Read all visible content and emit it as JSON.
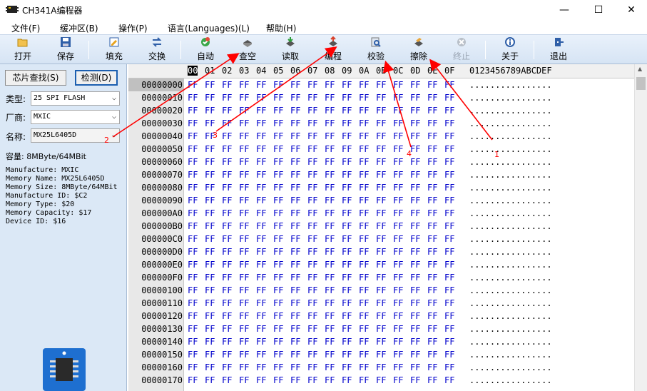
{
  "window": {
    "title": "CH341A编程器"
  },
  "menu": [
    "文件(F)",
    "缓冲区(B)",
    "操作(P)",
    "语言(Languages)(L)",
    "帮助(H)"
  ],
  "toolbar": [
    {
      "label": "打开",
      "icon": "folder-open-icon",
      "enabled": true
    },
    {
      "label": "保存",
      "icon": "save-icon",
      "enabled": true
    },
    {
      "label": "填充",
      "icon": "fill-icon",
      "enabled": true
    },
    {
      "label": "交换",
      "icon": "swap-icon",
      "enabled": true
    },
    {
      "label": "自动",
      "icon": "auto-icon",
      "enabled": true
    },
    {
      "label": "查空",
      "icon": "blank-check-icon",
      "enabled": true
    },
    {
      "label": "读取",
      "icon": "read-icon",
      "enabled": true
    },
    {
      "label": "编程",
      "icon": "program-icon",
      "enabled": true
    },
    {
      "label": "校验",
      "icon": "verify-icon",
      "enabled": true
    },
    {
      "label": "擦除",
      "icon": "erase-icon",
      "enabled": true
    },
    {
      "label": "终止",
      "icon": "stop-icon",
      "enabled": false
    },
    {
      "label": "关于",
      "icon": "info-icon",
      "enabled": true
    },
    {
      "label": "退出",
      "icon": "exit-icon",
      "enabled": true
    }
  ],
  "left_panel": {
    "find_chip_button": "芯片查找(S)",
    "detect_button": "检测(D)",
    "type_label": "类型:",
    "type_value": "25 SPI FLASH",
    "vendor_label": "厂商:",
    "vendor_value": "MXIC",
    "name_label": "名称:",
    "name_value": "MX25L6405D",
    "capacity_line": "容量: 8MByte/64MBit",
    "info_lines": [
      "Manufacture: MXIC",
      "Memory Name: MX25L6405D",
      "Memory Size: 8MByte/64MBit",
      "Manufacture ID: $C2",
      "Memory Type: $20",
      "Memory Capacity: $17",
      "Device ID: $16"
    ]
  },
  "hex_view": {
    "columns": [
      "00",
      "01",
      "02",
      "03",
      "04",
      "05",
      "06",
      "07",
      "08",
      "09",
      "0A",
      "0B",
      "0C",
      "0D",
      "0E",
      "0F"
    ],
    "ascii_header": "0123456789ABCDEF",
    "addresses": [
      "00000000",
      "00000010",
      "00000020",
      "00000030",
      "00000040",
      "00000050",
      "00000060",
      "00000070",
      "00000080",
      "00000090",
      "000000A0",
      "000000B0",
      "000000C0",
      "000000D0",
      "000000E0",
      "000000F0",
      "00000100",
      "00000110",
      "00000120",
      "00000130",
      "00000140",
      "00000150",
      "00000160",
      "00000170"
    ],
    "byte_value": "FF",
    "ascii_row": "................"
  },
  "annotations": [
    "1",
    "2",
    "3",
    "4"
  ],
  "colors": {
    "annotation": "#ff0000",
    "hex_text": "#0000cc",
    "toolbar_bg": "#dbe8f6"
  }
}
